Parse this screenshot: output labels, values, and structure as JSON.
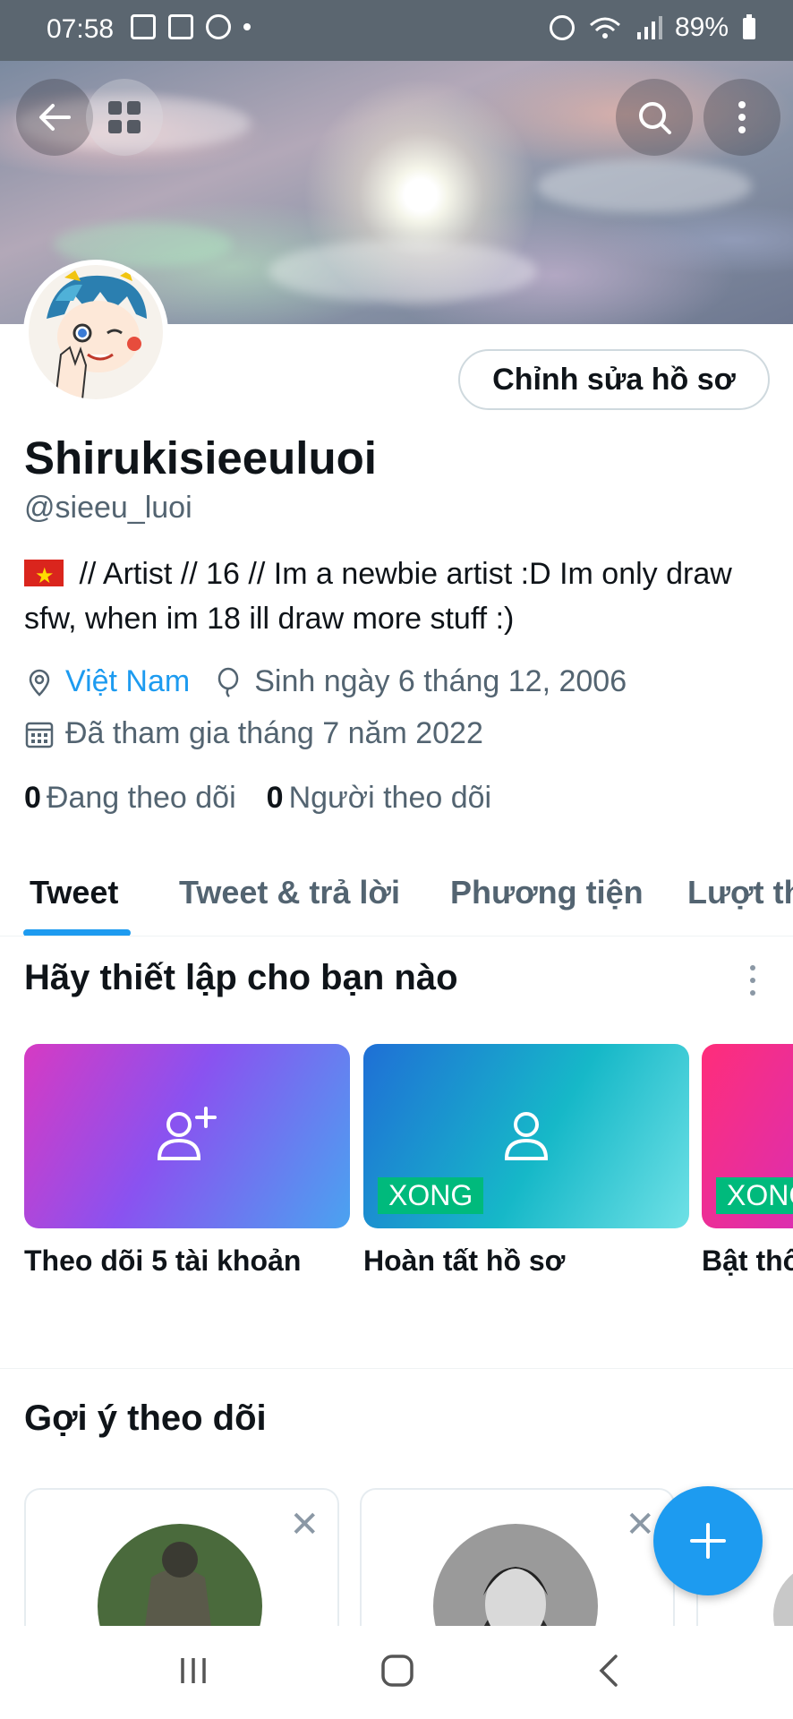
{
  "status_bar": {
    "time": "07:58",
    "battery": "89%"
  },
  "header": {
    "back_icon": "arrow-left-icon",
    "grid_icon": "grid-icon",
    "search_icon": "search-icon",
    "more_icon": "more-vertical-icon"
  },
  "profile": {
    "edit_button": "Chỉnh sửa hồ sơ",
    "display_name": "Shirukisieeuluoi",
    "handle": "@sieeu_luoi",
    "bio": " // Artist // 16 //  Im a newbie artist :D Im only draw sfw, when im 18 ill draw more stuff :)",
    "location": "Việt Nam",
    "birthday": "Sinh ngày 6 tháng 12, 2006",
    "joined": "Đã tham gia tháng 7 năm 2022",
    "following_count": "0",
    "following_label": "Đang theo dõi",
    "followers_count": "0",
    "followers_label": "Người theo dõi"
  },
  "tabs": [
    {
      "label": "Tweet",
      "active": true
    },
    {
      "label": "Tweet & trả lời"
    },
    {
      "label": "Phương tiện"
    },
    {
      "label": "Lượt thích"
    }
  ],
  "setup": {
    "title": "Hãy thiết lập cho bạn nào",
    "cards": [
      {
        "label": "Theo dõi 5 tài khoản",
        "badge": ""
      },
      {
        "label": "Hoàn tất hồ sơ",
        "badge": "XONG"
      },
      {
        "label": "Bật thông báo",
        "badge": "XONG"
      }
    ]
  },
  "suggestions": {
    "title": "Gợi ý theo dõi",
    "close_symbol": "✕"
  },
  "colors": {
    "accent": "#1d9bf0",
    "done_badge": "#00ba7c",
    "text_secondary": "#536471"
  }
}
